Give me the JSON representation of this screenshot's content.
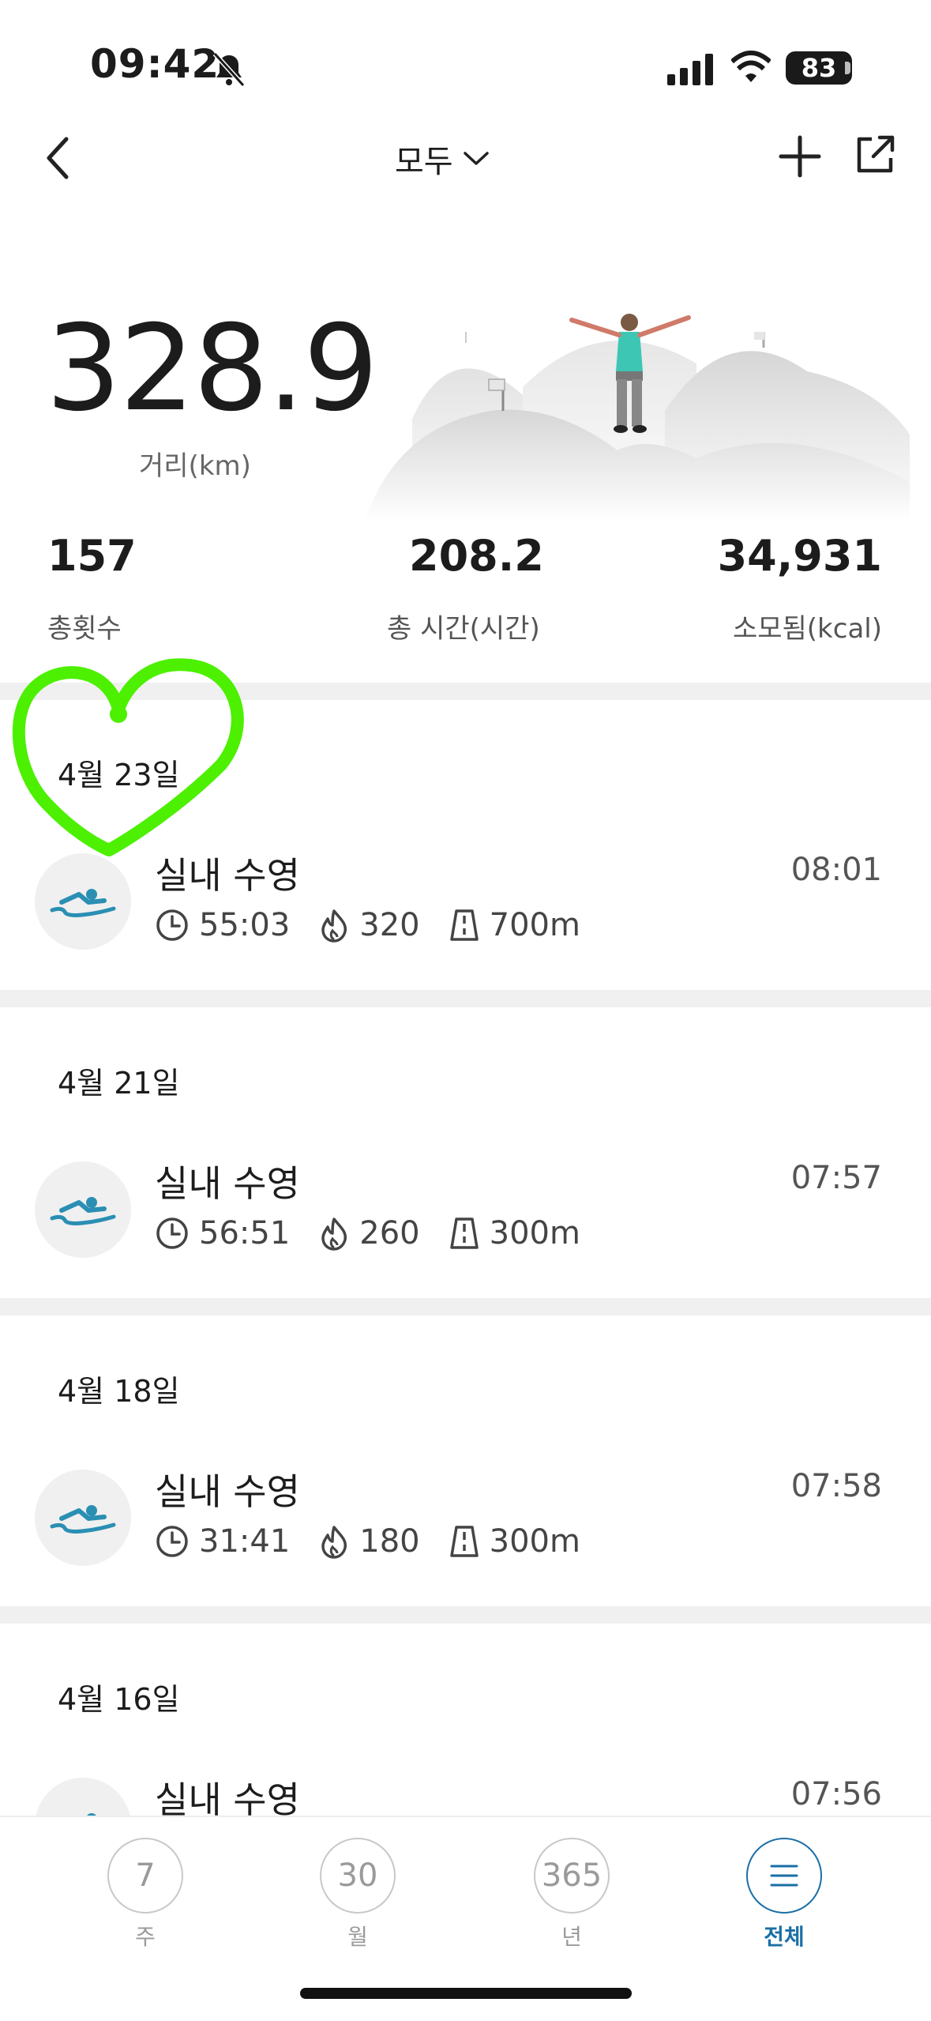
{
  "status_bar": {
    "time": "09:42",
    "battery": "83"
  },
  "header": {
    "filter_label": "모두"
  },
  "summary": {
    "distance_value": "328.9",
    "distance_label": "거리(km)",
    "stats": [
      {
        "value": "157",
        "label": "총횟수"
      },
      {
        "value": "208.2",
        "label": "총 시간(시간)"
      },
      {
        "value": "34,931",
        "label": "소모됨(kcal)"
      }
    ]
  },
  "records": [
    {
      "date": "4월 23일",
      "title": "실내 수영",
      "start_time": "08:01",
      "duration": "55:03",
      "calories": "320",
      "distance": "700m"
    },
    {
      "date": "4월 21일",
      "title": "실내 수영",
      "start_time": "07:57",
      "duration": "56:51",
      "calories": "260",
      "distance": "300m"
    },
    {
      "date": "4월 18일",
      "title": "실내 수영",
      "start_time": "07:58",
      "duration": "31:41",
      "calories": "180",
      "distance": "300m"
    },
    {
      "date": "4월 16일",
      "title": "실내 수영",
      "start_time": "07:56"
    }
  ],
  "bottom_nav": [
    {
      "circle": "7",
      "label": "주"
    },
    {
      "circle": "30",
      "label": "월"
    },
    {
      "circle": "365",
      "label": "년"
    },
    {
      "circle": "",
      "label": "전체"
    }
  ],
  "colors": {
    "accent": "#1a6fa6",
    "swim_icon": "#2a8fb3",
    "annotation": "#4cf000"
  }
}
